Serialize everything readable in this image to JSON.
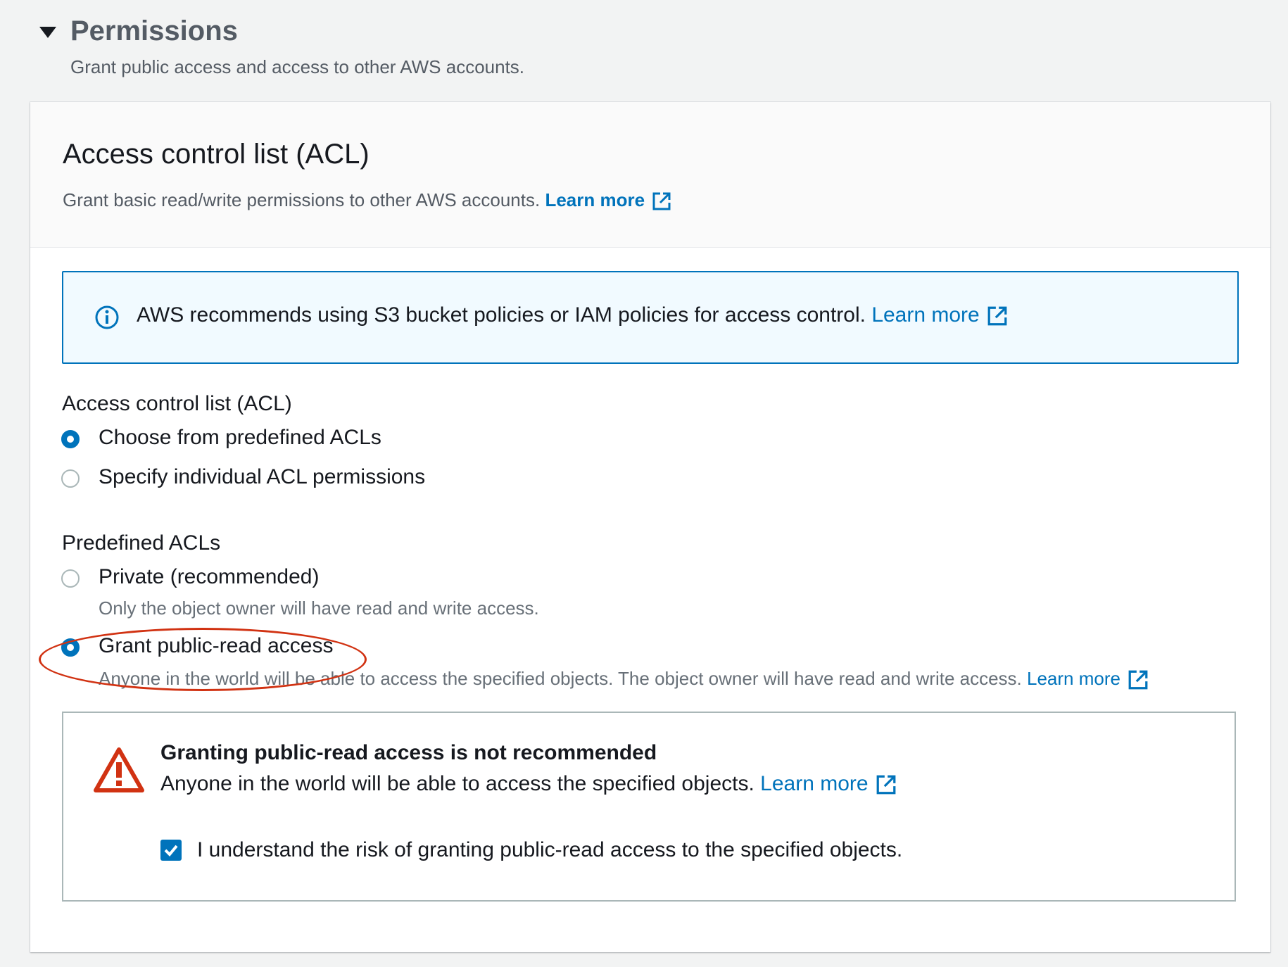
{
  "section": {
    "title": "Permissions",
    "description": "Grant public access and access to other AWS accounts."
  },
  "panel": {
    "title": "Access control list (ACL)",
    "description": "Grant basic read/write permissions to other AWS accounts.",
    "learn_more": "Learn more"
  },
  "info_alert": {
    "text": "AWS recommends using S3 bucket policies or IAM policies for access control.",
    "learn_more": "Learn more"
  },
  "acl_group": {
    "label": "Access control list (ACL)",
    "options": [
      {
        "label": "Choose from predefined ACLs",
        "checked": true
      },
      {
        "label": "Specify individual ACL permissions",
        "checked": false
      }
    ]
  },
  "predefined_group": {
    "label": "Predefined ACLs",
    "options": [
      {
        "label": "Private (recommended)",
        "description": "Only the object owner will have read and write access.",
        "checked": false
      },
      {
        "label": "Grant public-read access",
        "description": "Anyone in the world will be able to access the specified objects. The object owner will have read and write access.",
        "learn_more": "Learn more",
        "checked": true
      }
    ]
  },
  "warning": {
    "title": "Granting public-read access is not recommended",
    "text": "Anyone in the world will be able to access the specified objects.",
    "learn_more": "Learn more",
    "acknowledge_label": "I understand the risk of granting public-read access to the specified objects.",
    "acknowledge_checked": true
  },
  "colors": {
    "link": "#0073bb",
    "warning_icon": "#d13212",
    "annotation": "#d13212"
  }
}
